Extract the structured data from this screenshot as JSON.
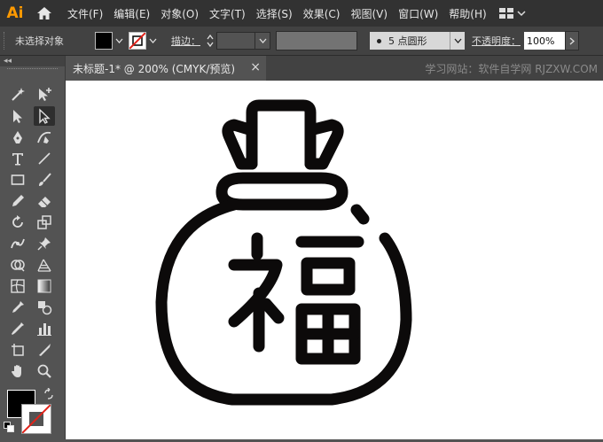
{
  "app": {
    "logo": "Ai"
  },
  "menu": [
    "文件(F)",
    "编辑(E)",
    "对象(O)",
    "文字(T)",
    "选择(S)",
    "效果(C)",
    "视图(V)",
    "窗口(W)",
    "帮助(H)"
  ],
  "control": {
    "selection": "未选择对象",
    "stroke_label": "描边：",
    "brush": "5 点圆形",
    "opacity_label": "不透明度：",
    "opacity_value": "100%"
  },
  "tabbar": {
    "tab_title": "未标题-1* @ 200% (CMYK/预览)",
    "close": "×",
    "watermark": "学习网站：软件自学网  RJZXW.COM"
  },
  "toolbar": {
    "collapse": "◂◂"
  },
  "colors": {
    "fill": "#000000",
    "stroke": "none",
    "canvas": "#ffffff",
    "ui_dark": "#323232",
    "ui_mid": "#535353",
    "accent": "#ff9a00"
  },
  "artwork": {
    "character": "福"
  }
}
